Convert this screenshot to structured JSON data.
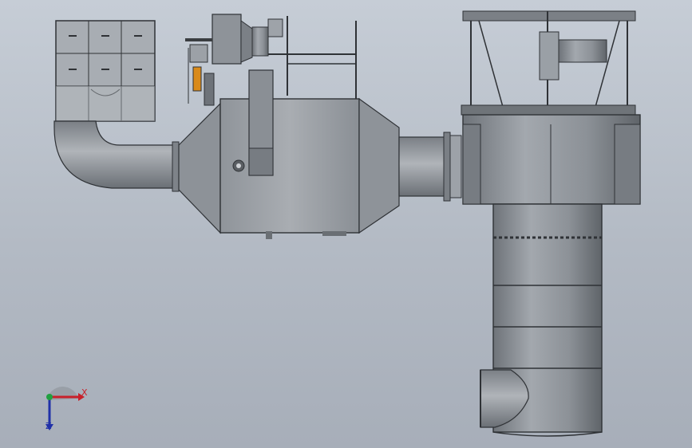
{
  "viewport": {
    "background_top": "#c6cdd6",
    "background_bottom": "#a7aeb9"
  },
  "model": {
    "body_color": "#9ca1a7",
    "shadow_color": "#6d7278",
    "line_color": "#33363a",
    "accent_color": "#d98a1a"
  },
  "triad": {
    "x_label": "X",
    "z_label": "Z",
    "x_color": "#c8202a",
    "y_color": "#20a040",
    "z_color": "#2030a8"
  }
}
